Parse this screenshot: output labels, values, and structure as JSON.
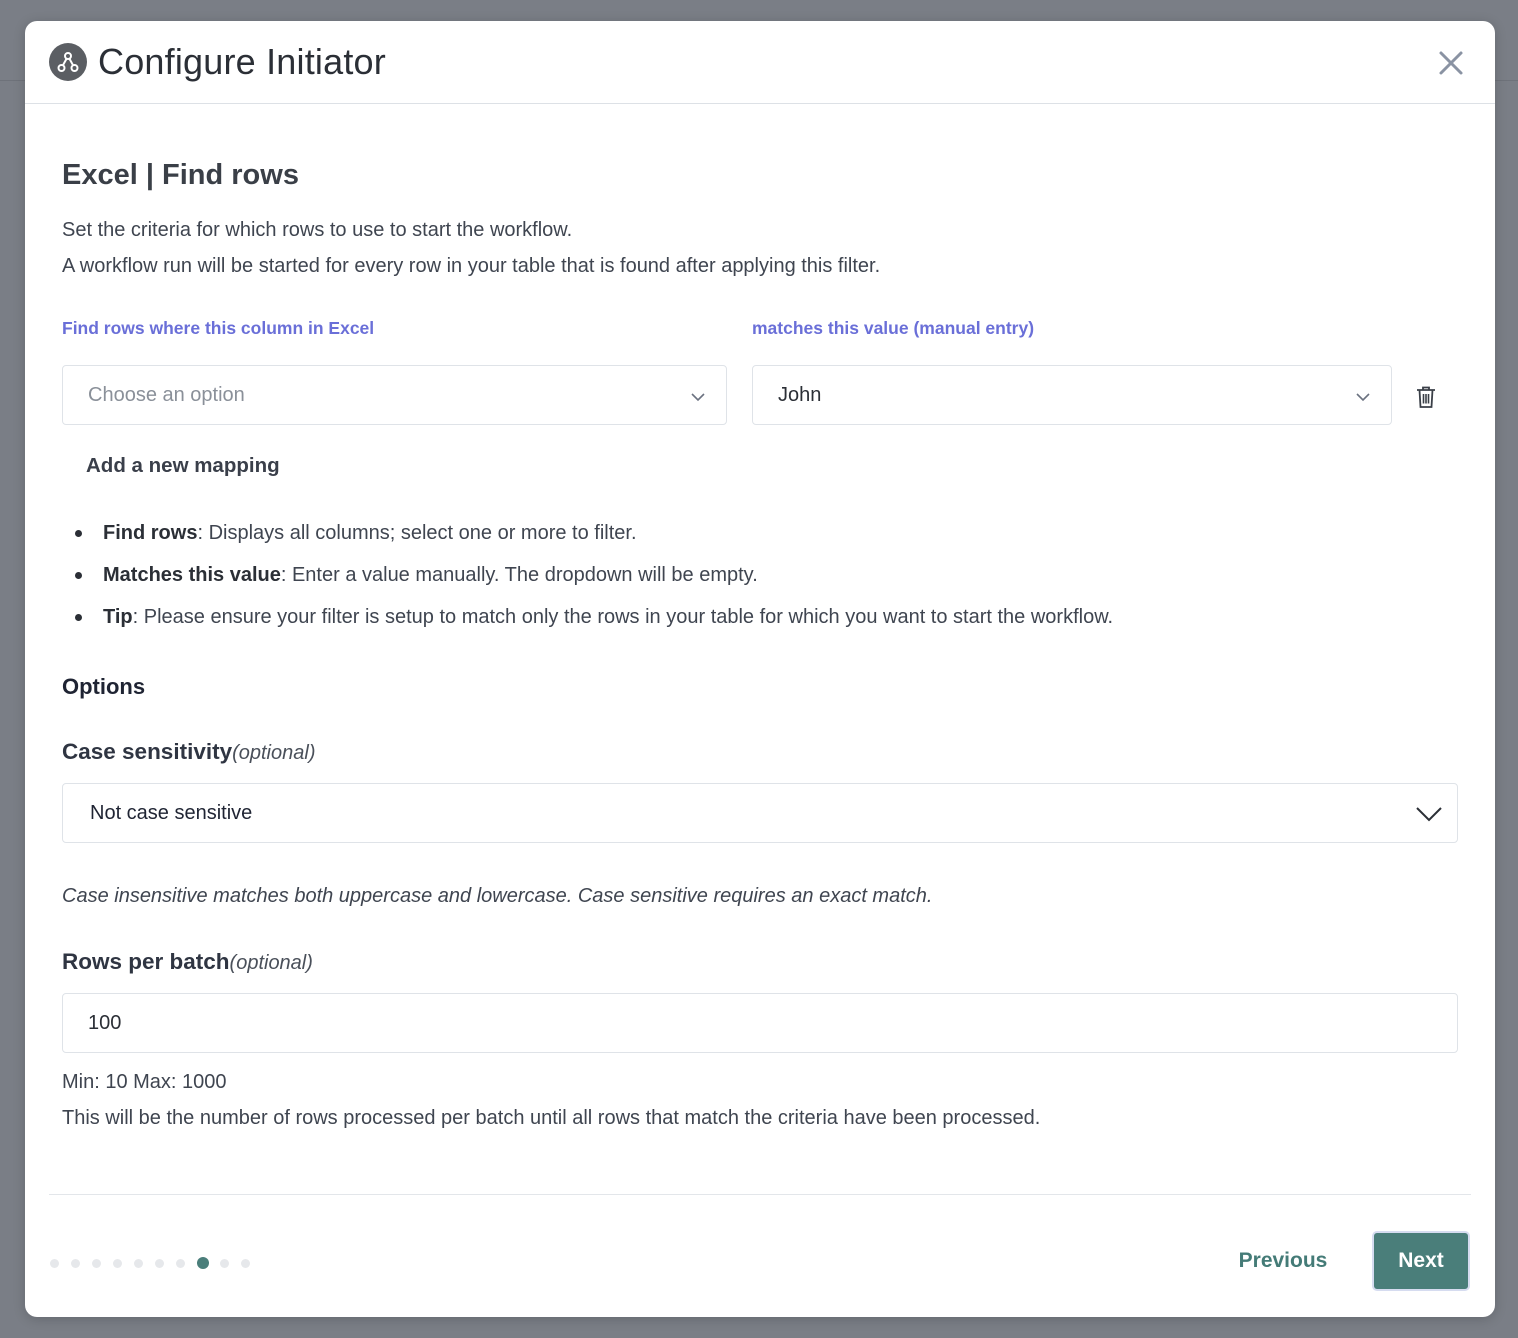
{
  "modal": {
    "title": "Configure Initiator",
    "header_icon": "workflow-nodes-icon",
    "close_icon": "close-icon"
  },
  "section": {
    "title": "Excel | Find rows",
    "description_line1": "Set the criteria for which rows to use to start the workflow.",
    "description_line2": "A workflow run will be started for every row in your table that is found after applying this filter."
  },
  "mapping": {
    "column_label": "Find rows where this column in Excel",
    "value_label": "matches this value (manual entry)",
    "column_placeholder": "Choose an option",
    "value_selected": "John",
    "delete_icon": "trash-icon",
    "add_label": "Add a new mapping"
  },
  "help": [
    {
      "term": "Find rows",
      "text": ": Displays all columns; select one or more to filter."
    },
    {
      "term": "Matches this value",
      "text": ": Enter a value manually. The dropdown will be empty."
    },
    {
      "term": "Tip",
      "text": ": Please ensure your filter is setup to match only the rows in your table for which you want to start the workflow."
    }
  ],
  "options": {
    "heading": "Options",
    "case_label": "Case sensitivity",
    "optional_tag": "(optional)",
    "case_value": "Not case sensitive",
    "case_hint": "Case insensitive matches both uppercase and lowercase. Case sensitive requires an exact match.",
    "batch_label": "Rows per batch",
    "batch_value": "100",
    "batch_minmax": "Min: 10 Max: 1000",
    "batch_desc": "This will be the number of rows processed per batch until all rows that match the criteria have been processed."
  },
  "footer": {
    "steps_total": 10,
    "current_step": 8,
    "previous_label": "Previous",
    "next_label": "Next",
    "accent_color": "#4a7e7a",
    "label_color": "#6a6fd8"
  }
}
